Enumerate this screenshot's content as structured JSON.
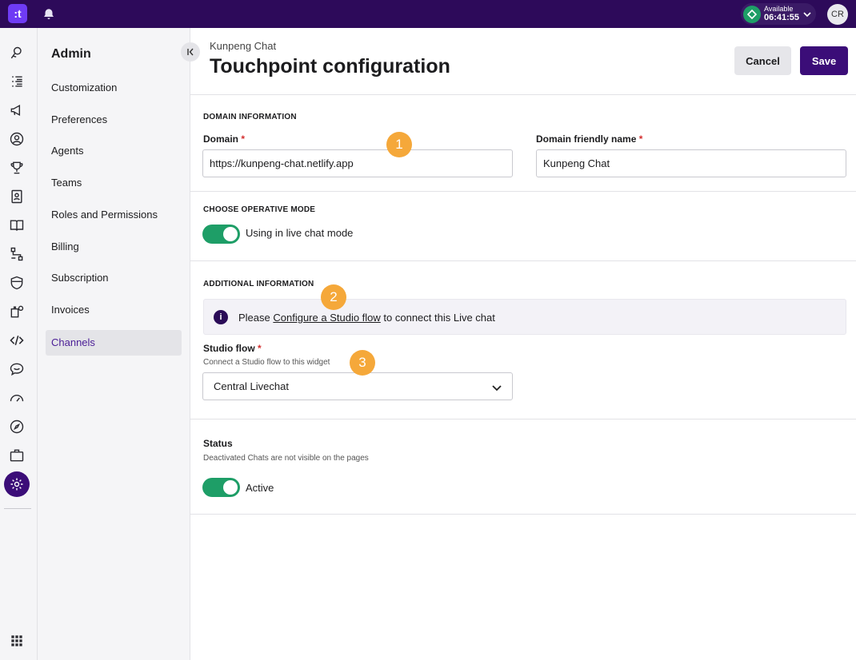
{
  "app": {
    "logo_text": ":t"
  },
  "topbar": {
    "status_label": "Available",
    "status_time": "06:41:55",
    "avatar_initials": "CR"
  },
  "sidebar": {
    "title": "Admin",
    "items": [
      {
        "label": "Customization"
      },
      {
        "label": "Preferences"
      },
      {
        "label": "Agents"
      },
      {
        "label": "Teams"
      },
      {
        "label": "Roles and Permissions"
      },
      {
        "label": "Billing"
      },
      {
        "label": "Subscription"
      },
      {
        "label": "Invoices"
      },
      {
        "label": "Channels"
      }
    ],
    "active_item": "Channels"
  },
  "header": {
    "breadcrumb": "Kunpeng Chat",
    "title": "Touchpoint configuration",
    "cancel_label": "Cancel",
    "save_label": "Save"
  },
  "domain_section": {
    "heading": "DOMAIN INFORMATION",
    "domain_label": "Domain",
    "domain_value": "https://kunpeng-chat.netlify.app",
    "friendly_label": "Domain friendly name",
    "friendly_value": "Kunpeng Chat",
    "required_mark": "*"
  },
  "mode_section": {
    "heading": "CHOOSE OPERATIVE MODE",
    "toggle_label": "Using in live chat mode",
    "toggle_on": true
  },
  "additional_section": {
    "heading": "ADDITIONAL INFORMATION",
    "info_prefix": "Please ",
    "info_link": "Configure a Studio flow",
    "info_suffix": " to connect this Live chat",
    "studio_label": "Studio flow",
    "studio_hint": "Connect a Studio flow to this widget",
    "studio_value": "Central Livechat"
  },
  "status_section": {
    "title": "Status",
    "hint": "Deactivated Chats are not visible on the pages",
    "toggle_label": "Active",
    "toggle_on": true
  },
  "annotations": [
    "1",
    "2",
    "3"
  ],
  "colors": {
    "topbar": "#2d0a5a",
    "brand": "#3b0d78",
    "toggle_on": "#1e9e67",
    "annotation": "#f5a83a",
    "required": "#d32f2f"
  }
}
